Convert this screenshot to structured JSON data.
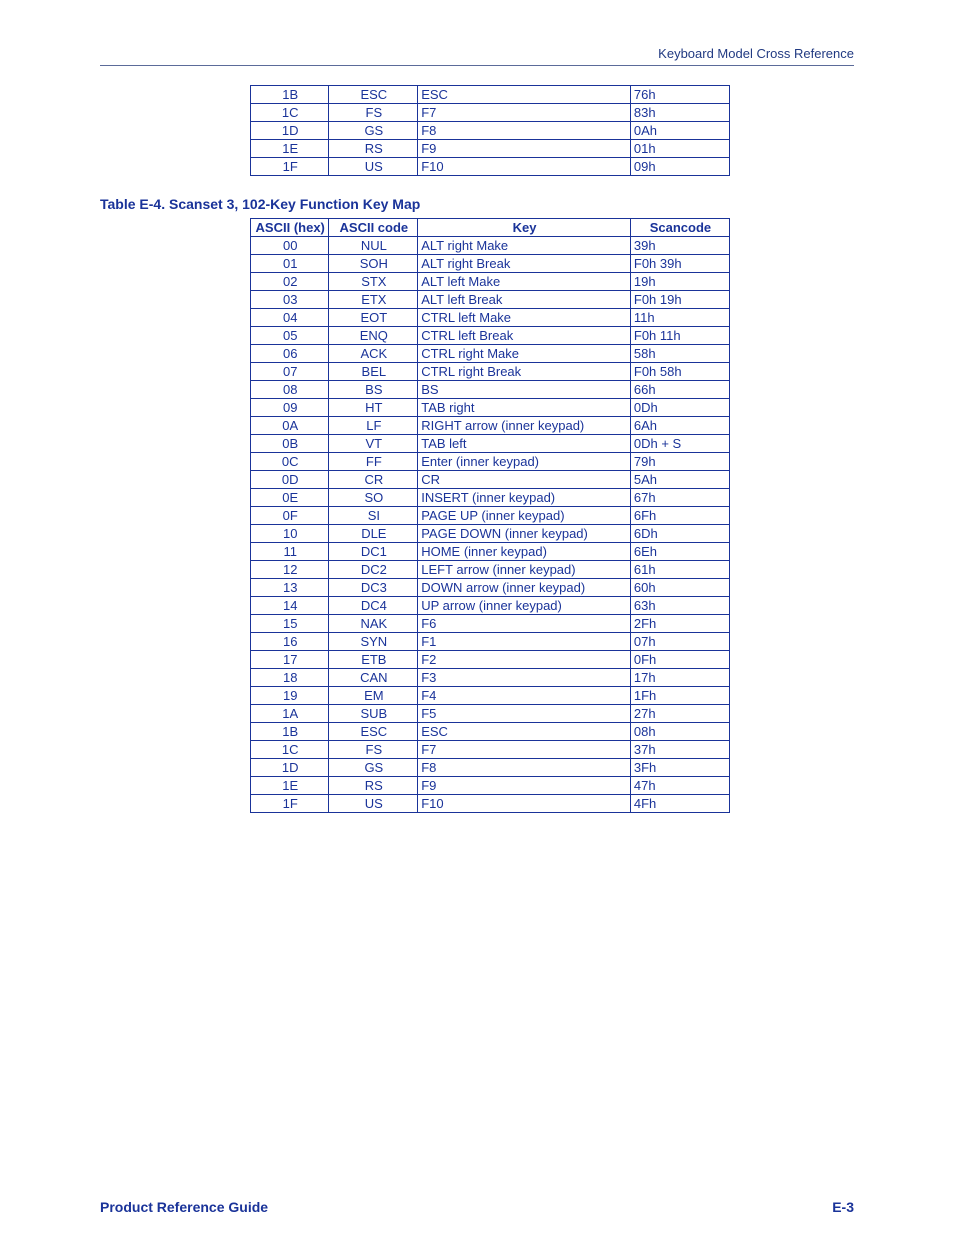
{
  "header": {
    "running_head": "Keyboard Model Cross Reference"
  },
  "footer": {
    "left": "Product Reference Guide",
    "right": "E-3"
  },
  "table_top": {
    "rows": [
      {
        "ascii": "1B",
        "code": "ESC",
        "key": "ESC",
        "scan": "76h"
      },
      {
        "ascii": "1C",
        "code": "FS",
        "key": "F7",
        "scan": "83h"
      },
      {
        "ascii": "1D",
        "code": "GS",
        "key": "F8",
        "scan": "0Ah"
      },
      {
        "ascii": "1E",
        "code": "RS",
        "key": "F9",
        "scan": "01h"
      },
      {
        "ascii": "1F",
        "code": "US",
        "key": "F10",
        "scan": "09h"
      }
    ]
  },
  "caption": {
    "label": "Table E-4",
    "sep": ". ",
    "title": "Scanset 3, 102-Key Function Key Map"
  },
  "table_main": {
    "headers": {
      "c1": "ASCII (hex)",
      "c2": "ASCII code",
      "c3": "Key",
      "c4": "Scancode"
    },
    "rows": [
      {
        "ascii": "00",
        "code": "NUL",
        "key": "ALT right Make",
        "scan": "39h"
      },
      {
        "ascii": "01",
        "code": "SOH",
        "key": "ALT right Break",
        "scan": "F0h 39h"
      },
      {
        "ascii": "02",
        "code": "STX",
        "key": "ALT left Make",
        "scan": "19h"
      },
      {
        "ascii": "03",
        "code": "ETX",
        "key": "ALT left Break",
        "scan": "F0h 19h"
      },
      {
        "ascii": "04",
        "code": "EOT",
        "key": "CTRL left Make",
        "scan": "11h"
      },
      {
        "ascii": "05",
        "code": "ENQ",
        "key": "CTRL left Break",
        "scan": "F0h 11h"
      },
      {
        "ascii": "06",
        "code": "ACK",
        "key": "CTRL right Make",
        "scan": "58h"
      },
      {
        "ascii": "07",
        "code": "BEL",
        "key": "CTRL right Break",
        "scan": "F0h 58h"
      },
      {
        "ascii": "08",
        "code": "BS",
        "key": "BS",
        "scan": "66h"
      },
      {
        "ascii": "09",
        "code": "HT",
        "key": "TAB right",
        "scan": "0Dh"
      },
      {
        "ascii": "0A",
        "code": "LF",
        "key": "RIGHT arrow (inner keypad)",
        "scan": "6Ah"
      },
      {
        "ascii": "0B",
        "code": "VT",
        "key": "TAB left",
        "scan": "0Dh + S"
      },
      {
        "ascii": "0C",
        "code": "FF",
        "key": "Enter (inner keypad)",
        "scan": "79h"
      },
      {
        "ascii": "0D",
        "code": "CR",
        "key": "CR",
        "scan": "5Ah"
      },
      {
        "ascii": "0E",
        "code": "SO",
        "key": "INSERT (inner keypad)",
        "scan": "67h"
      },
      {
        "ascii": "0F",
        "code": "SI",
        "key": "PAGE UP (inner keypad)",
        "scan": "6Fh"
      },
      {
        "ascii": "10",
        "code": "DLE",
        "key": "PAGE DOWN (inner keypad)",
        "scan": "6Dh"
      },
      {
        "ascii": "11",
        "code": "DC1",
        "key": "HOME (inner keypad)",
        "scan": "6Eh"
      },
      {
        "ascii": "12",
        "code": "DC2",
        "key": "LEFT arrow (inner keypad)",
        "scan": "61h"
      },
      {
        "ascii": "13",
        "code": "DC3",
        "key": "DOWN arrow (inner keypad)",
        "scan": "60h"
      },
      {
        "ascii": "14",
        "code": "DC4",
        "key": "UP arrow (inner keypad)",
        "scan": "63h"
      },
      {
        "ascii": "15",
        "code": "NAK",
        "key": "F6",
        "scan": "2Fh"
      },
      {
        "ascii": "16",
        "code": "SYN",
        "key": "F1",
        "scan": "07h"
      },
      {
        "ascii": "17",
        "code": "ETB",
        "key": "F2",
        "scan": "0Fh"
      },
      {
        "ascii": "18",
        "code": "CAN",
        "key": "F3",
        "scan": "17h"
      },
      {
        "ascii": "19",
        "code": "EM",
        "key": "F4",
        "scan": "1Fh"
      },
      {
        "ascii": "1A",
        "code": "SUB",
        "key": "F5",
        "scan": "27h"
      },
      {
        "ascii": "1B",
        "code": "ESC",
        "key": "ESC",
        "scan": "08h"
      },
      {
        "ascii": "1C",
        "code": "FS",
        "key": "F7",
        "scan": "37h"
      },
      {
        "ascii": "1D",
        "code": "GS",
        "key": "F8",
        "scan": "3Fh"
      },
      {
        "ascii": "1E",
        "code": "RS",
        "key": "F9",
        "scan": "47h"
      },
      {
        "ascii": "1F",
        "code": "US",
        "key": "F10",
        "scan": "4Fh"
      }
    ]
  }
}
